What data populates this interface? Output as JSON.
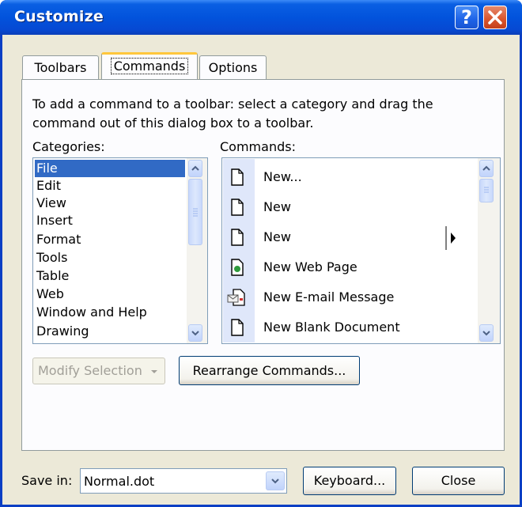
{
  "window": {
    "title": "Customize"
  },
  "tabs": [
    {
      "label": "Toolbars",
      "active": false
    },
    {
      "label": "Commands",
      "active": true
    },
    {
      "label": "Options",
      "active": false
    }
  ],
  "instructions": "To add a command to a toolbar: select a category and drag the command out of this dialog box to a toolbar.",
  "instructions_lines": [
    "To add a command to a toolbar: select a category and drag the",
    "command out of this dialog box to a toolbar."
  ],
  "categories": {
    "label": "Categories:",
    "items": [
      "File",
      "Edit",
      "View",
      "Insert",
      "Format",
      "Tools",
      "Table",
      "Web",
      "Window and Help",
      "Drawing"
    ],
    "selected": "File"
  },
  "commands": {
    "label": "Commands:",
    "items": [
      {
        "label": "New...",
        "icon": "blank-document-icon"
      },
      {
        "label": "New",
        "icon": "blank-document-icon"
      },
      {
        "label": "New",
        "icon": "blank-document-icon",
        "submenu": true
      },
      {
        "label": "New Web Page",
        "icon": "web-page-icon"
      },
      {
        "label": "New E-mail Message",
        "icon": "email-message-icon"
      },
      {
        "label": "New Blank Document",
        "icon": "blank-document-icon"
      }
    ]
  },
  "buttons": {
    "modify_selection": "Modify Selection",
    "rearrange": "Rearrange Commands...",
    "keyboard": "Keyboard...",
    "close": "Close"
  },
  "save_in": {
    "label": "Save in:",
    "value": "Normal.dot"
  },
  "colors": {
    "title_bar": "#0a5fe3",
    "dialog_bg": "#ece9d8",
    "selection": "#316ac5",
    "close_button": "#d9542c"
  }
}
